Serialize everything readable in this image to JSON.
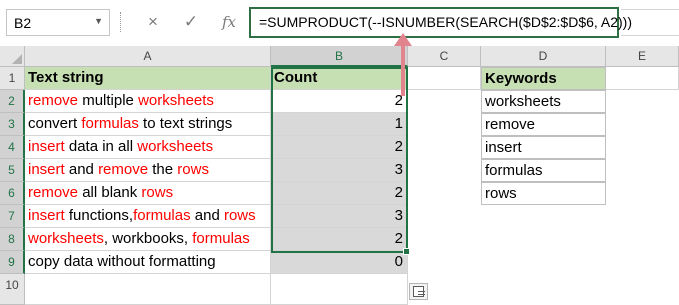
{
  "formula_bar": {
    "name_box": "B2",
    "cancel_icon": "×",
    "enter_icon": "✓",
    "fx_label": "fx",
    "formula": "=SUMPRODUCT(--ISNUMBER(SEARCH($D$2:$D$6, A2)))"
  },
  "columns": [
    "A",
    "B",
    "C",
    "D",
    "E"
  ],
  "rows": [
    "1",
    "2",
    "3",
    "4",
    "5",
    "6",
    "7",
    "8",
    "9",
    "10"
  ],
  "headers": {
    "text_string": "Text string",
    "count": "Count",
    "keywords": "Keywords"
  },
  "text_strings": [
    [
      {
        "t": "remove",
        "red": true
      },
      {
        "t": " multiple "
      },
      {
        "t": "worksheets",
        "red": true
      }
    ],
    [
      {
        "t": "convert "
      },
      {
        "t": "formulas",
        "red": true
      },
      {
        "t": " to text strings"
      }
    ],
    [
      {
        "t": "insert",
        "red": true
      },
      {
        "t": " data in all "
      },
      {
        "t": "worksheets",
        "red": true
      }
    ],
    [
      {
        "t": "insert",
        "red": true
      },
      {
        "t": " and "
      },
      {
        "t": "remove",
        "red": true
      },
      {
        "t": " the "
      },
      {
        "t": "rows",
        "red": true
      }
    ],
    [
      {
        "t": "remove",
        "red": true
      },
      {
        "t": " all blank "
      },
      {
        "t": "rows",
        "red": true
      }
    ],
    [
      {
        "t": "insert",
        "red": true
      },
      {
        "t": " functions,"
      },
      {
        "t": "formulas",
        "red": true
      },
      {
        "t": " and "
      },
      {
        "t": "rows",
        "red": true
      }
    ],
    [
      {
        "t": "worksheets",
        "red": true
      },
      {
        "t": ", workbooks, "
      },
      {
        "t": "formulas",
        "red": true
      }
    ],
    [
      {
        "t": "copy data without formatting"
      }
    ]
  ],
  "counts": [
    "2",
    "1",
    "2",
    "3",
    "2",
    "3",
    "2",
    "0"
  ],
  "keywords": [
    "worksheets",
    "remove",
    "insert",
    "formulas",
    "rows"
  ],
  "colors": {
    "highlight_red": "#ff0000",
    "header_green": "#c6e0b4",
    "selection_green": "#217346",
    "arrow_pink": "#e2848e"
  }
}
